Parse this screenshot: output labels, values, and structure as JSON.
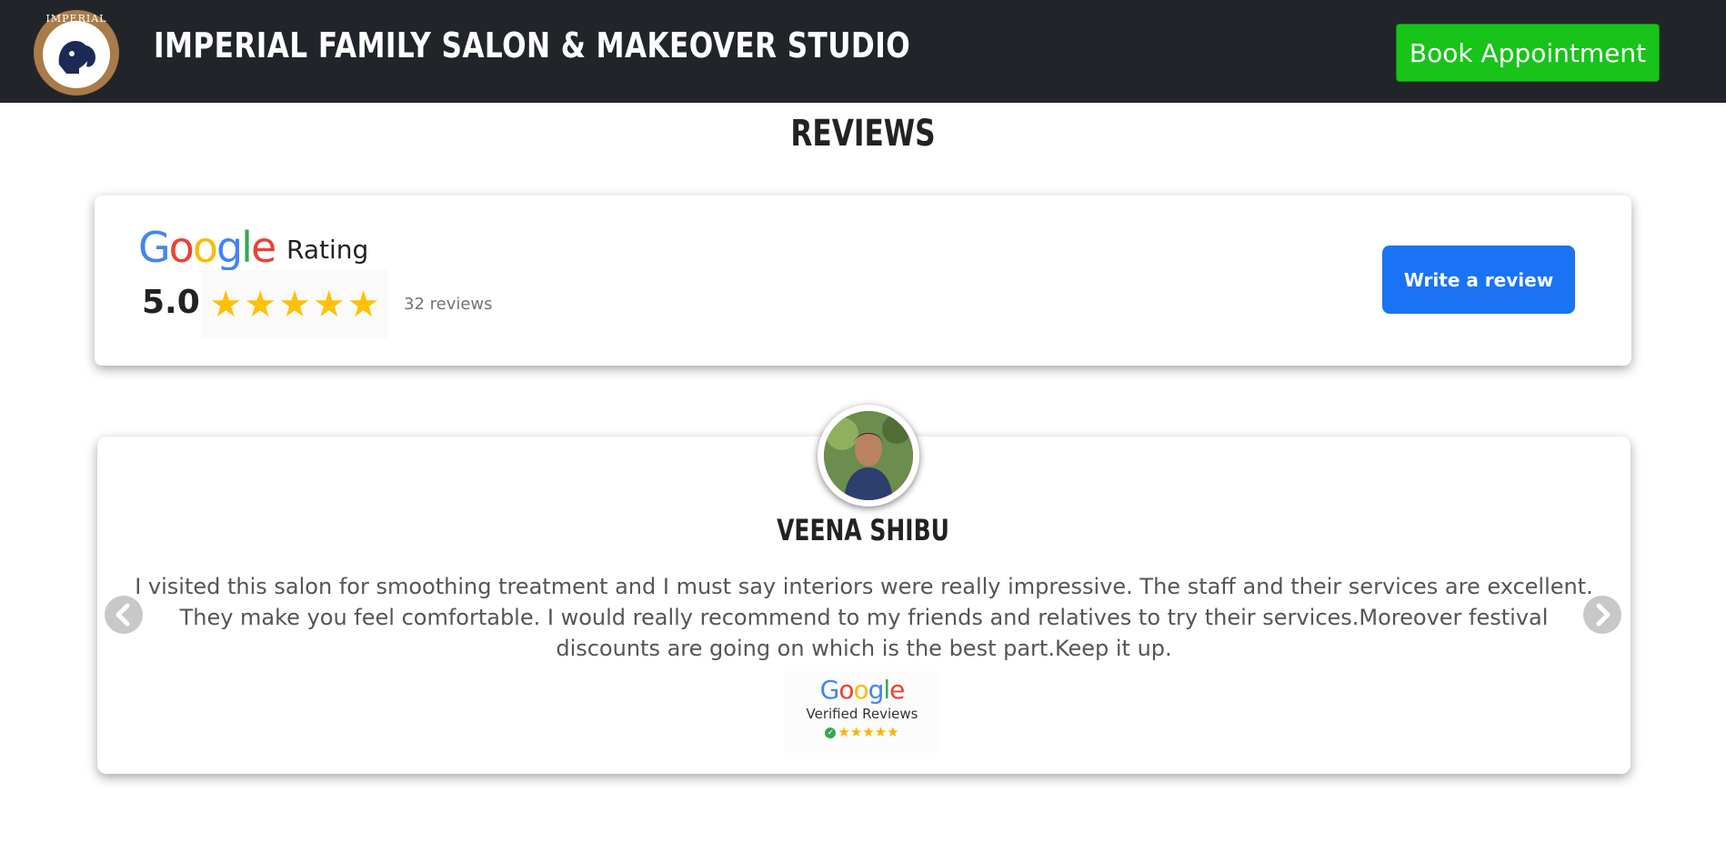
{
  "header": {
    "logo_text": "IMPERIAL",
    "title": "IMPERIAL FAMILY SALON & MAKEOVER STUDIO",
    "book_button_label": "Book Appointment",
    "colors": {
      "background": "#212529",
      "book_button": "#18c31a"
    }
  },
  "reviews_section": {
    "title": "REVIEWS"
  },
  "google_rating": {
    "brand_letters": [
      "G",
      "o",
      "o",
      "g",
      "l",
      "e"
    ],
    "label": "Rating",
    "score": "5.0",
    "stars": 5,
    "review_count": "32 reviews",
    "write_review_label": "Write a review",
    "colors": {
      "star": "#ffc107",
      "write_button": "#1a73f2"
    }
  },
  "featured_review": {
    "reviewer_name": "VEENA SHIBU",
    "text": "I visited this salon for smoothing treatment and I must say interiors were really impressive. The staff and their services are excellent. They make you feel comfortable. I would really recommend to my friends and relatives to try their services.Moreover festival discounts are going on which is the best part.Keep it up.",
    "badge": {
      "brand": "Google",
      "label": "Verified Reviews",
      "stars": 5
    },
    "prev_icon": "chevron-left-icon",
    "next_icon": "chevron-right-icon"
  }
}
